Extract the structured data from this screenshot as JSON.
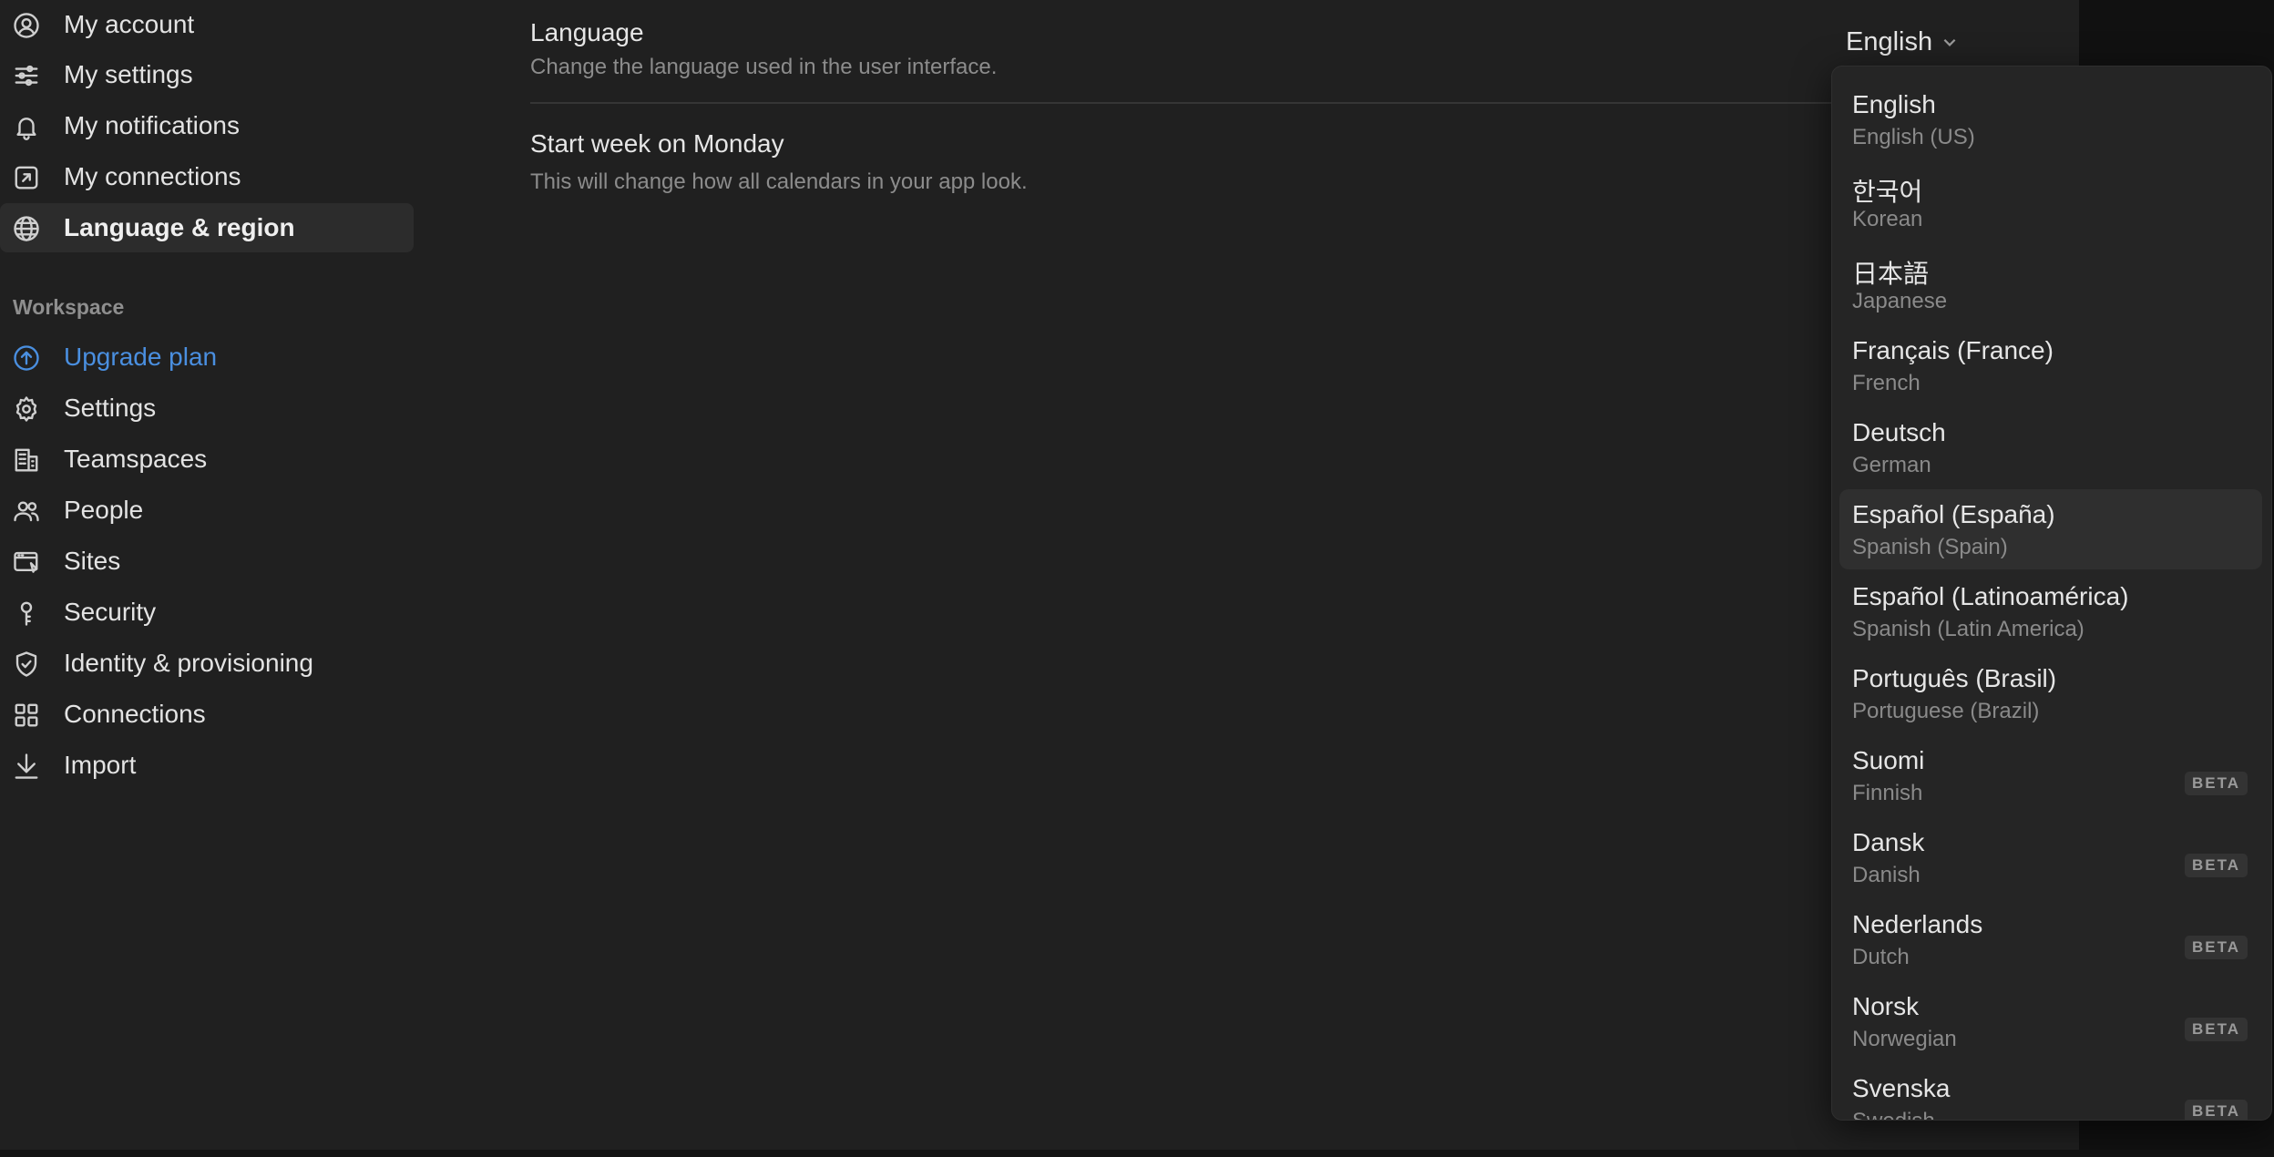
{
  "sidebar": {
    "account_items": [
      {
        "label": "My account",
        "icon": "user-circle-icon"
      },
      {
        "label": "My settings",
        "icon": "sliders-icon"
      },
      {
        "label": "My notifications",
        "icon": "bell-icon"
      },
      {
        "label": "My connections",
        "icon": "external-link-icon"
      },
      {
        "label": "Language & region",
        "icon": "globe-icon",
        "active": true
      }
    ],
    "workspace_label": "Workspace",
    "workspace_items": [
      {
        "label": "Upgrade plan",
        "icon": "arrow-up-circle-icon"
      },
      {
        "label": "Settings",
        "icon": "gear-icon"
      },
      {
        "label": "Teamspaces",
        "icon": "building-icon"
      },
      {
        "label": "People",
        "icon": "people-icon"
      },
      {
        "label": "Sites",
        "icon": "browser-window-icon"
      },
      {
        "label": "Security",
        "icon": "key-icon"
      },
      {
        "label": "Identity & provisioning",
        "icon": "shield-check-icon"
      },
      {
        "label": "Connections",
        "icon": "grid-icon"
      },
      {
        "label": "Import",
        "icon": "download-icon"
      }
    ]
  },
  "main": {
    "language": {
      "title": "Language",
      "description": "Change the language used in the user interface.",
      "selected": "English"
    },
    "week": {
      "title": "Start week on Monday",
      "description": "This will change how all calendars in your app look."
    }
  },
  "dropdown": {
    "options": [
      {
        "name": "English",
        "sub": "English (US)",
        "beta": ""
      },
      {
        "name": "한국어",
        "sub": "Korean",
        "beta": ""
      },
      {
        "name": "日本語",
        "sub": "Japanese",
        "beta": ""
      },
      {
        "name": "Français (France)",
        "sub": "French",
        "beta": ""
      },
      {
        "name": "Deutsch",
        "sub": "German",
        "beta": ""
      },
      {
        "name": "Español (España)",
        "sub": "Spanish (Spain)",
        "beta": ""
      },
      {
        "name": "Español (Latinoamérica)",
        "sub": "Spanish (Latin America)",
        "beta": ""
      },
      {
        "name": "Português (Brasil)",
        "sub": "Portuguese (Brazil)",
        "beta": ""
      },
      {
        "name": "Suomi",
        "sub": "Finnish",
        "beta": "BETA"
      },
      {
        "name": "Dansk",
        "sub": "Danish",
        "beta": "BETA"
      },
      {
        "name": "Nederlands",
        "sub": "Dutch",
        "beta": "BETA"
      },
      {
        "name": "Norsk",
        "sub": "Norwegian",
        "beta": "BETA"
      },
      {
        "name": "Svenska",
        "sub": "Swedish",
        "beta": "BETA"
      }
    ],
    "highlighted": "Español (España)"
  },
  "colors": {
    "accent": "#4a8fe0",
    "background": "#202020",
    "sidebar_active": "#2c2c2c"
  }
}
